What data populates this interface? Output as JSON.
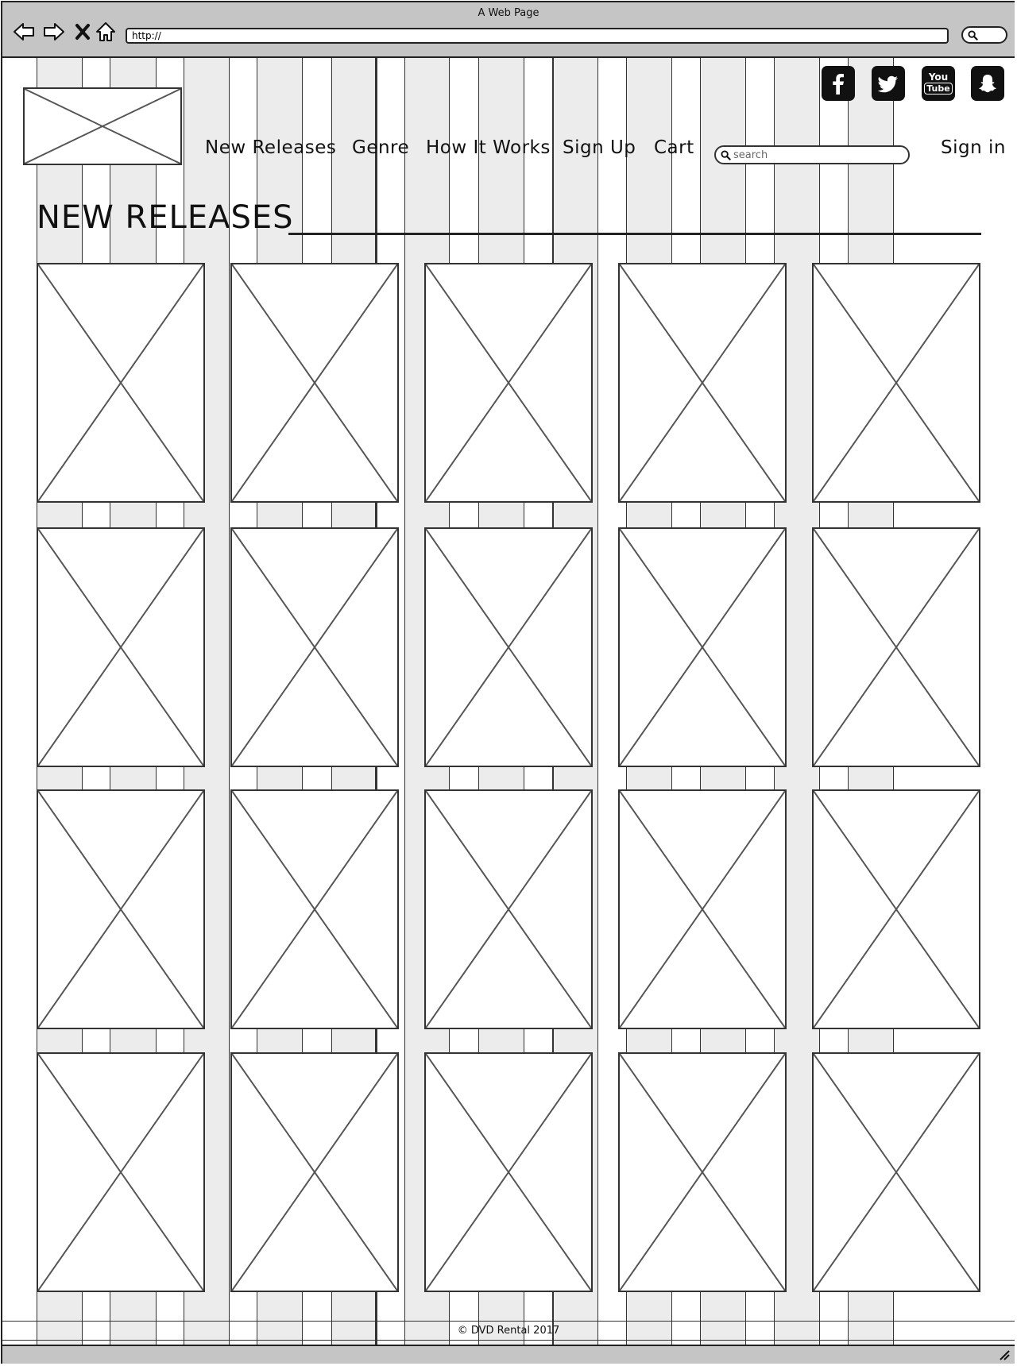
{
  "browser": {
    "title": "A Web Page",
    "url": "http://",
    "nav_icons": [
      "back-arrow-icon",
      "forward-arrow-icon",
      "close-x-icon",
      "home-icon"
    ],
    "search_icon": "magnifier-icon"
  },
  "header": {
    "logo": "image-placeholder",
    "nav": [
      {
        "label": "New Releases"
      },
      {
        "label": "Genre"
      },
      {
        "label": "How It Works"
      },
      {
        "label": "Sign Up"
      },
      {
        "label": "Cart"
      }
    ],
    "search_placeholder": "search",
    "sign_in": "Sign in",
    "social": [
      "facebook-icon",
      "twitter-icon",
      "youtube-icon",
      "snapchat-icon"
    ],
    "youtube_text": {
      "top": "You",
      "bottom": "Tube"
    }
  },
  "main": {
    "section_title": "NEW RELEASES",
    "grid": {
      "rows": 4,
      "columns": 5,
      "tile": "image-placeholder"
    }
  },
  "footer": {
    "text": "© DVD Rental 2017"
  },
  "colors": {
    "chrome": "#c5c5c5",
    "grid_column": "#ececec",
    "stroke": "#333333",
    "page": "#ffffff"
  }
}
